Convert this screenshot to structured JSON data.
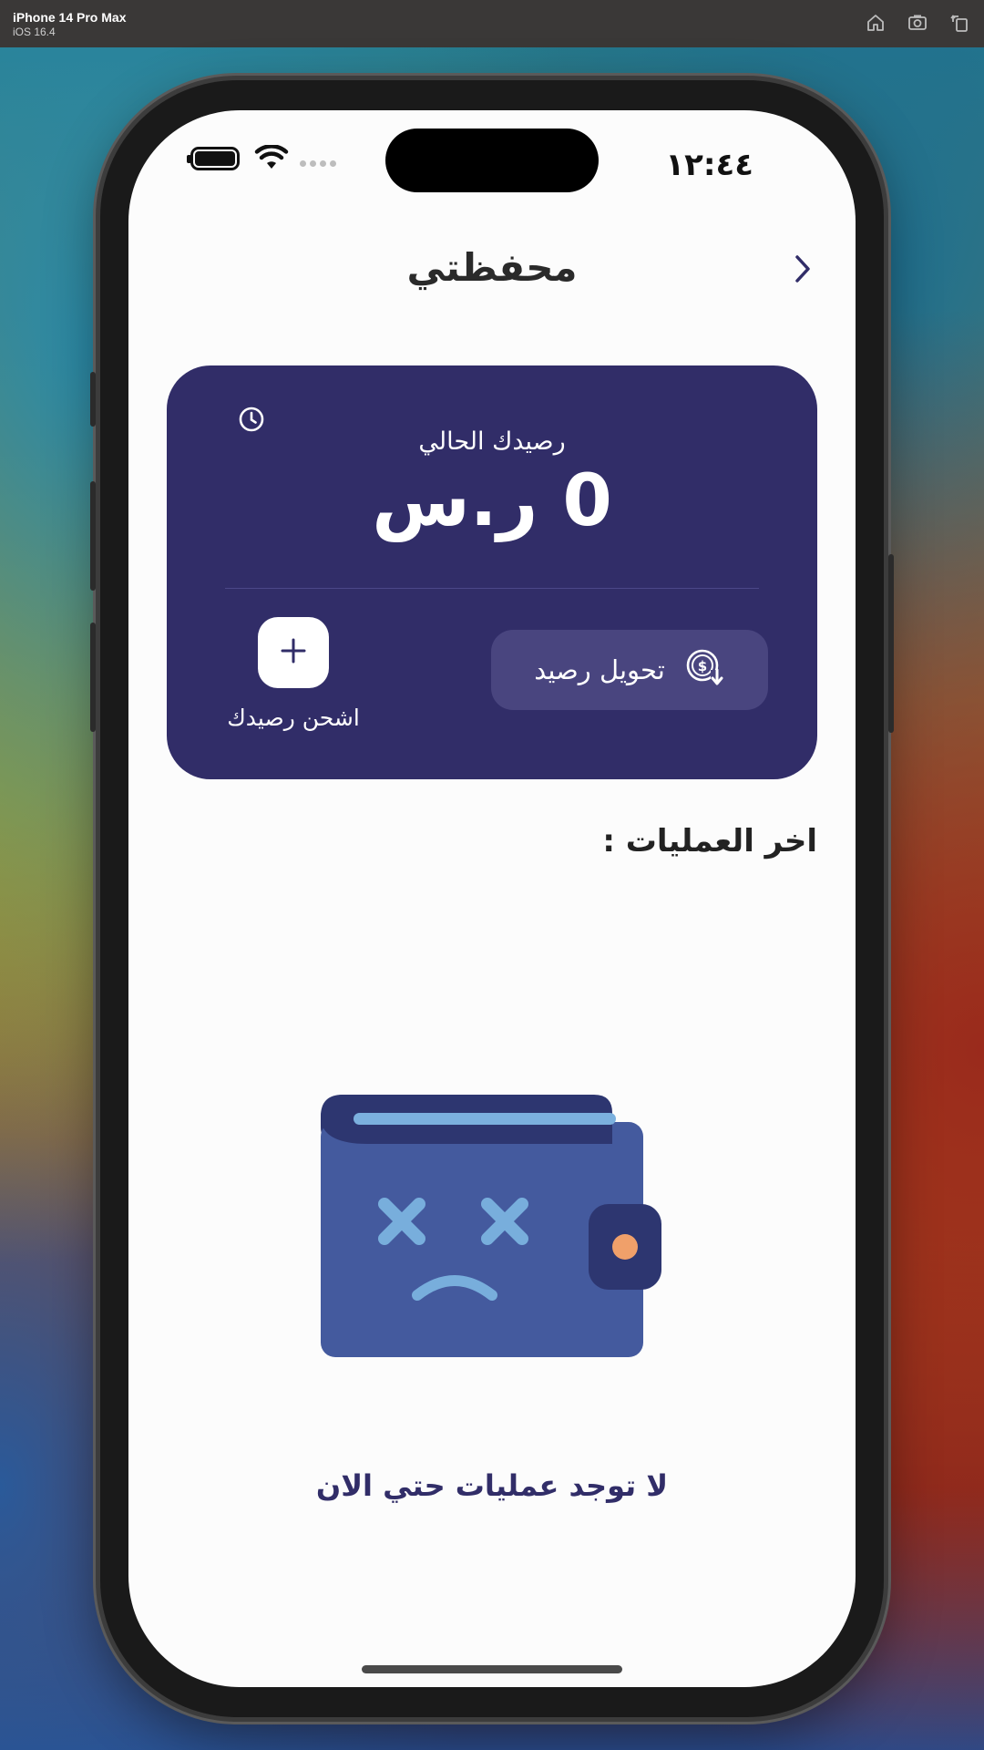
{
  "simulator": {
    "device_name": "iPhone 14 Pro Max",
    "os_version": "iOS 16.4",
    "icons": [
      "home-icon",
      "screenshot-icon",
      "rotate-icon"
    ]
  },
  "status_bar": {
    "time": "١٢:٤٤"
  },
  "header": {
    "title": "محفظتي",
    "back_icon": "chevron-right-icon"
  },
  "wallet_card": {
    "background": "#312d68",
    "balance_label": "رصيدك الحالي",
    "balance_value": "0 ر.س",
    "history_icon": "clock-icon",
    "transfer_button_label": "تحويل رصيد",
    "transfer_icon": "dollar-coin-download-icon",
    "recharge_label": "اشحن رصيدك",
    "recharge_icon": "plus-icon"
  },
  "transactions": {
    "title": "اخر العمليات :",
    "empty_icon": "sad-wallet-icon",
    "empty_message": "لا توجد عمليات حتي الان"
  }
}
